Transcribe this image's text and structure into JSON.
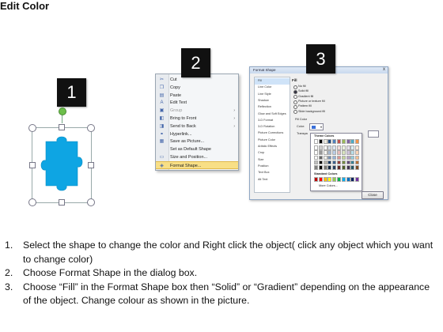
{
  "title": "Edit Color",
  "badges": [
    "1",
    "2",
    "3"
  ],
  "colors": {
    "puzzle": "#0ea5e3",
    "badge": "#111111",
    "highlight": "#f8df86",
    "rotate_handle": "#6cbf4a"
  },
  "context_menu": {
    "items": [
      {
        "icon": "cut-icon",
        "label": "Cut",
        "disabled": false,
        "submenu": false
      },
      {
        "icon": "copy-icon",
        "label": "Copy",
        "disabled": false,
        "submenu": false
      },
      {
        "icon": "paste-icon",
        "label": "Paste",
        "disabled": false,
        "submenu": false
      },
      {
        "icon": "edit-text-icon",
        "label": "Edit Text",
        "disabled": false,
        "submenu": false
      },
      {
        "icon": "group-icon",
        "label": "Group",
        "disabled": true,
        "submenu": true
      },
      {
        "icon": "bring-front-icon",
        "label": "Bring to Front",
        "disabled": false,
        "submenu": true
      },
      {
        "icon": "send-back-icon",
        "label": "Send to Back",
        "disabled": false,
        "submenu": true
      },
      {
        "icon": "hyperlink-icon",
        "label": "Hyperlink...",
        "disabled": false,
        "submenu": false
      },
      {
        "icon": "save-picture-icon",
        "label": "Save as Picture...",
        "disabled": false,
        "submenu": false
      },
      {
        "icon": "default-shape-icon",
        "label": "Set as Default Shape",
        "disabled": false,
        "submenu": false
      },
      {
        "icon": "size-position-icon",
        "label": "Size and Position...",
        "disabled": false,
        "submenu": false
      },
      {
        "icon": "format-shape-icon",
        "label": "Format Shape...",
        "disabled": false,
        "submenu": false,
        "highlighted": true
      }
    ]
  },
  "dialog": {
    "title": "Format Shape",
    "close_x": "x",
    "nav": [
      "Fill",
      "Line Color",
      "Line Style",
      "Shadow",
      "Reflection",
      "Glow and Soft Edges",
      "3-D Format",
      "3-D Rotation",
      "Picture Corrections",
      "Picture Color",
      "Artistic Effects",
      "Crop",
      "Size",
      "Position",
      "Text Box",
      "Alt Text"
    ],
    "section": "Fill",
    "options": [
      {
        "label": "No fill",
        "checked": false
      },
      {
        "label": "Solid fill",
        "checked": true
      },
      {
        "label": "Gradient fill",
        "checked": false
      },
      {
        "label": "Picture or texture fill",
        "checked": false
      },
      {
        "label": "Pattern fill",
        "checked": false
      },
      {
        "label": "Slide background fill",
        "checked": false
      }
    ],
    "fill_color_label": "Fill Color",
    "color_label": "Color:",
    "transparency_label": "Transpa",
    "theme_colors_label": "Theme Colors",
    "standard_colors_label": "Standard Colors",
    "more_colors_label": "More Colors...",
    "close_button": "Close",
    "theme_columns": [
      "#ffffff",
      "#000000",
      "#eeece1",
      "#1f497d",
      "#4f81bd",
      "#c0504d",
      "#9bbb59",
      "#8064a2",
      "#4bacc6",
      "#f79646"
    ],
    "standard_colors": [
      "#c00000",
      "#ff0000",
      "#ffc000",
      "#ffff00",
      "#92d050",
      "#00b050",
      "#00b0f0",
      "#0070c0",
      "#002060",
      "#7030a0"
    ]
  },
  "steps": [
    {
      "num": "1.",
      "text": "Select the shape to change the color and Right click the object( click any object which you want to change color)"
    },
    {
      "num": "2.",
      "text": "Choose Format Shape in the dialog box."
    },
    {
      "num": "3.",
      "text": "Choose “Fill” in the Format Shape box then “Solid” or “Gradient” depending on the appearance of the object. Change colour as shown in the picture."
    }
  ]
}
